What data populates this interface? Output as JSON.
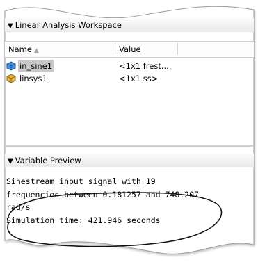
{
  "workspace": {
    "title": "Linear Analysis Workspace",
    "columns": {
      "name": "Name",
      "value": "Value"
    },
    "variables": [
      {
        "name": "in_sine1",
        "value": "<1x1 frest....",
        "icon": "frest-object-icon",
        "selected": true
      },
      {
        "name": "linsys1",
        "value": "<1x1 ss>",
        "icon": "ss-model-icon",
        "selected": false
      }
    ]
  },
  "preview": {
    "title": "Variable Preview",
    "lines": [
      "Sinestream input signal with 19",
      "frequencies between 0.181257 and 748.207",
      "rad/s",
      "Simulation time: 421.946 seconds"
    ]
  },
  "colors": {
    "header_gradient_top": "#fbfbfb",
    "header_gradient_bottom": "#e9e9e9",
    "selection": "#c8c8c8",
    "sort_arrow": "#a8a8a8",
    "frest_icon": "#4a90d9",
    "ss_icon": "#e2b64c"
  },
  "annotation": "hand-drawn ellipse around simulation time"
}
